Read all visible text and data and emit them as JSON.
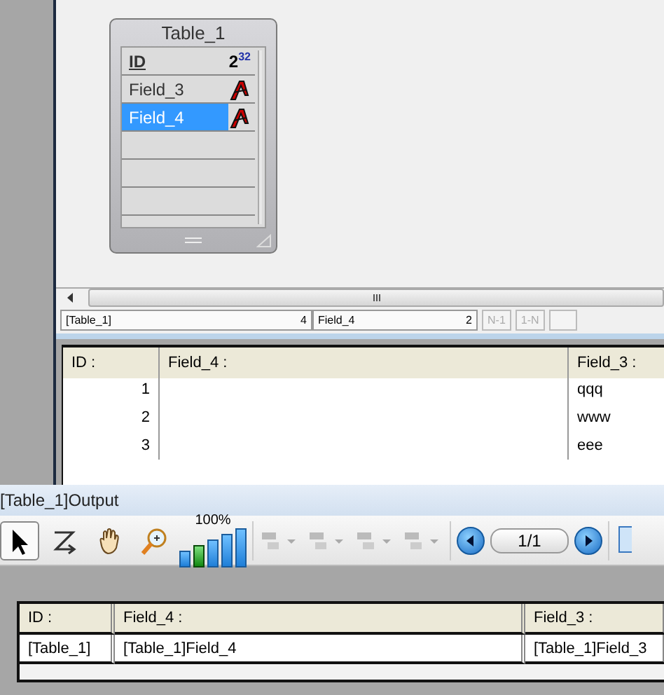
{
  "table_widget": {
    "title": "Table_1",
    "fields": [
      {
        "name": "ID",
        "kind": "integer",
        "key": true,
        "selected": false,
        "type_base": "2",
        "type_exp": "32"
      },
      {
        "name": "Field_3",
        "kind": "text",
        "key": false,
        "selected": false
      },
      {
        "name": "Field_4",
        "kind": "text",
        "key": false,
        "selected": true
      }
    ]
  },
  "status_bar": {
    "table": "[Table_1]",
    "table_count": "4",
    "field": "Field_4",
    "field_count": "2",
    "buttons": [
      {
        "label": "N-1",
        "disabled": true
      },
      {
        "label": "1-N",
        "disabled": true
      }
    ]
  },
  "grid": {
    "columns": [
      "ID :",
      "Field_4 :",
      "Field_3 :"
    ],
    "rows": [
      [
        "1",
        "",
        "qqq"
      ],
      [
        "2",
        "",
        "www"
      ],
      [
        "3",
        "",
        "eee"
      ]
    ]
  },
  "output": {
    "title": "[Table_1]Output",
    "tools": [
      {
        "kind": "pointer",
        "selected": true
      },
      {
        "kind": "zorder",
        "selected": false
      },
      {
        "kind": "hand",
        "selected": false
      },
      {
        "kind": "zoom",
        "selected": false
      }
    ],
    "zoom_label": "100%",
    "zoom_steps": [
      {
        "selected": false
      },
      {
        "selected": true
      },
      {
        "selected": false
      },
      {
        "selected": false
      },
      {
        "selected": false
      }
    ],
    "page": "1/1",
    "table": {
      "columns": [
        "ID :",
        "Field_4 :",
        "Field_3 :"
      ],
      "rows": [
        [
          "[Table_1]",
          "[Table_1]Field_4",
          "[Table_1]Field_3"
        ]
      ]
    }
  }
}
